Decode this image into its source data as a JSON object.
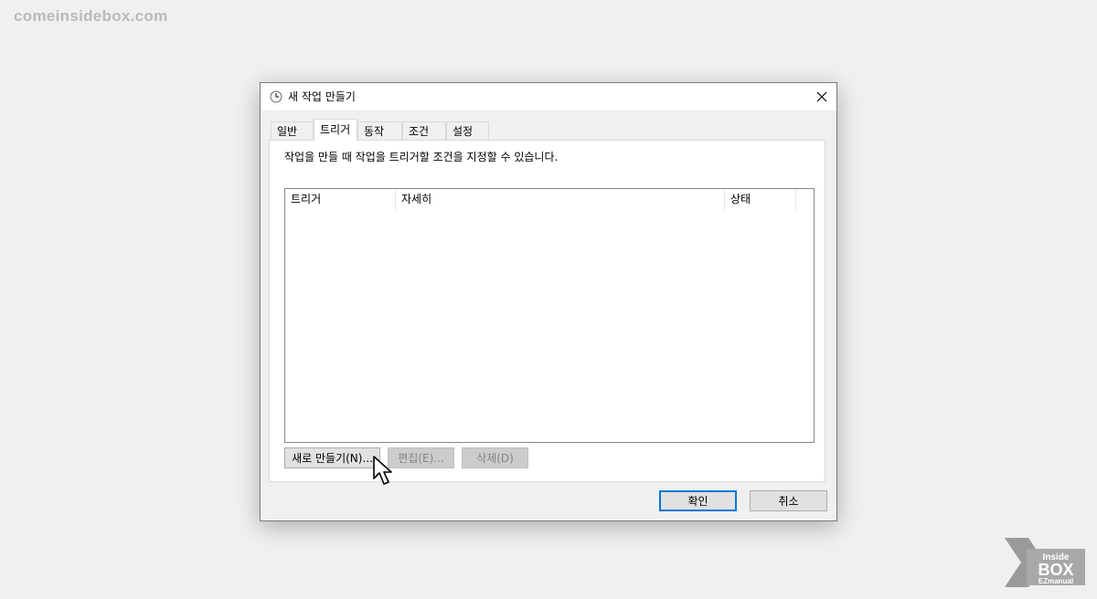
{
  "watermark": "comeinsidebox.com",
  "dialog": {
    "title": "새 작업 만들기",
    "close_glyph": "✕",
    "tabs": [
      {
        "label": "일반",
        "active": false
      },
      {
        "label": "트리거",
        "active": true
      },
      {
        "label": "동작",
        "active": false
      },
      {
        "label": "조건",
        "active": false
      },
      {
        "label": "설정",
        "active": false
      }
    ],
    "description": "작업을 만들 때 작업을 트리거할 조건을 지정할 수 있습니다.",
    "list": {
      "columns": [
        "트리거",
        "자세히",
        "상태"
      ],
      "rows": []
    },
    "buttons": {
      "new": "새로 만들기(N)...",
      "edit": "편집(E)...",
      "delete": "삭제(D)"
    },
    "footer": {
      "ok": "확인",
      "cancel": "취소"
    }
  },
  "logo": {
    "line1": "Inside",
    "line2": "BOX",
    "line3": "EZmanual"
  },
  "colors": {
    "accent": "#0078d7",
    "background": "#f0f0f0"
  }
}
